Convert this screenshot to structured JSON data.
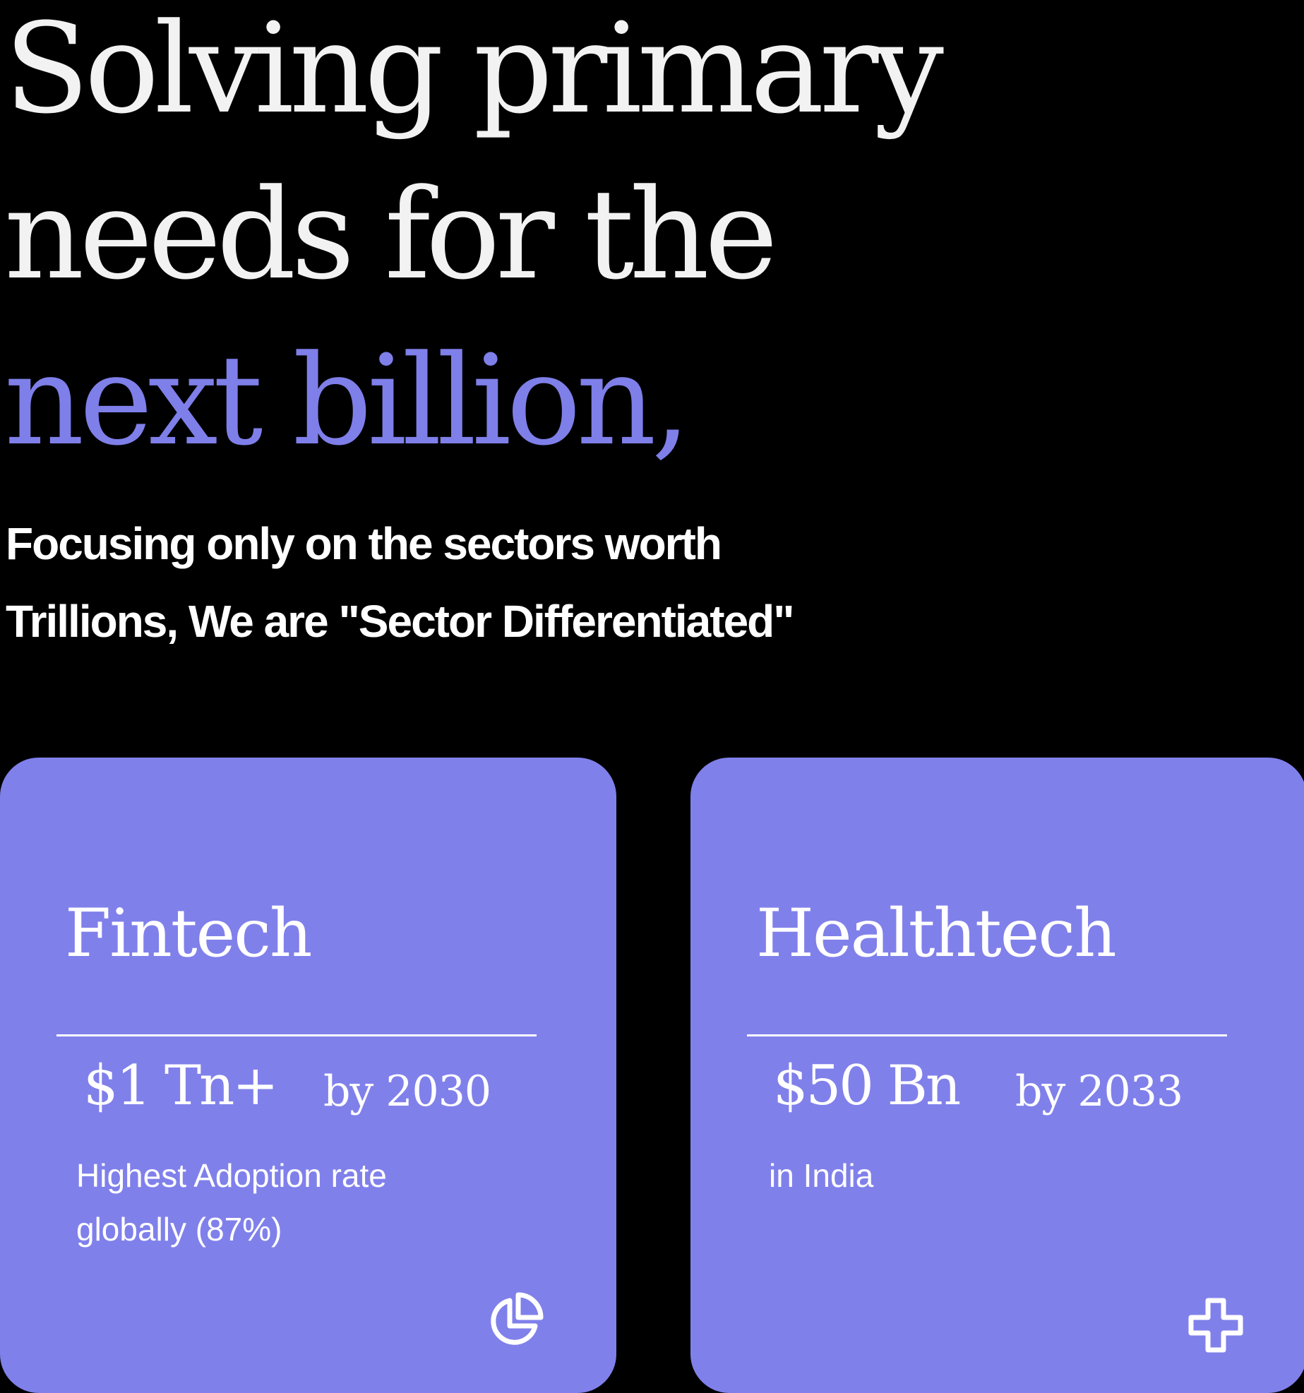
{
  "hero": {
    "headline_line1": "Solving primary",
    "headline_line2": "needs for the",
    "headline_accent": "next billion,",
    "subhead_line1": "Focusing only on the sectors worth",
    "subhead_line2": "Trillions, We are \"Sector Differentiated\""
  },
  "colors": {
    "background": "#000000",
    "headline": "#f2f2f2",
    "accent": "#7f7fe9",
    "card": "#8080eb",
    "card_text": "#ffffff"
  },
  "cards": [
    {
      "title": "Fintech",
      "stat": "$1 Tn+",
      "period": "by 2030",
      "desc_line1": "Highest Adoption rate",
      "desc_line2": "globally (87%)",
      "icon": "pie-chart-icon"
    },
    {
      "title": "Healthtech",
      "stat": "$50 Bn",
      "period": "by 2033",
      "desc_line1": "in India",
      "desc_line2": "",
      "icon": "medical-cross-icon"
    }
  ]
}
